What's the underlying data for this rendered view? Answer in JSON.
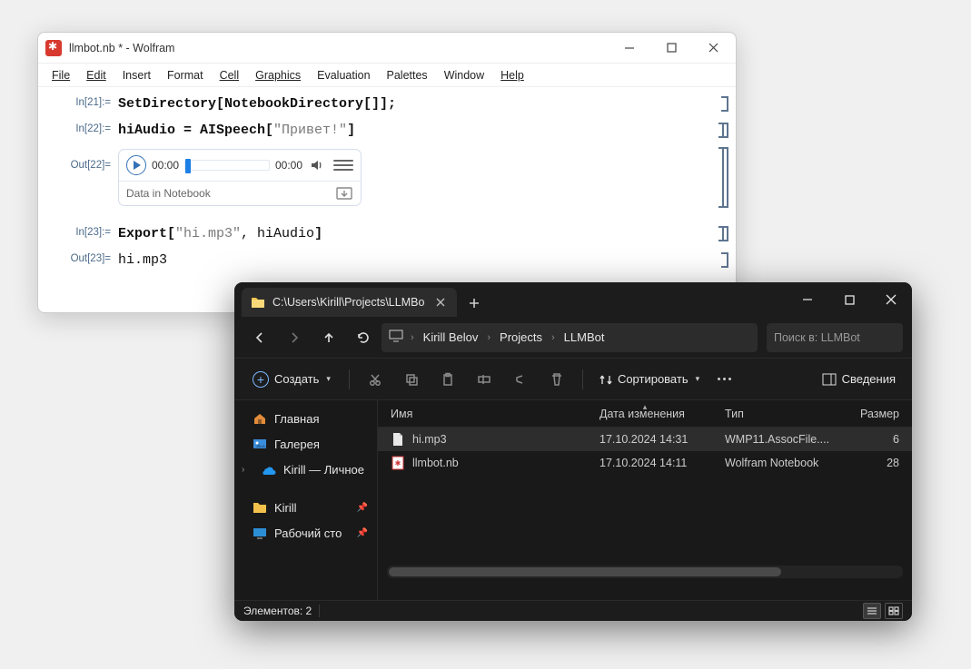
{
  "wolfram": {
    "title": "llmbot.nb * - Wolfram",
    "menu": {
      "file": "File",
      "edit": "Edit",
      "insert": "Insert",
      "format": "Format",
      "cell": "Cell",
      "graphics": "Graphics",
      "evaluation": "Evaluation",
      "palettes": "Palettes",
      "window": "Window",
      "help": "Help"
    },
    "cells": {
      "in21_label": "In[21]:=",
      "in21_code": "SetDirectory[NotebookDirectory[]];",
      "in22_label": "In[22]:=",
      "in22_fn": "hiAudio = AISpeech",
      "in22_str": "\"Привет!\"",
      "out22_label": "Out[22]=",
      "audio": {
        "t1": "00:00",
        "t2": "00:00",
        "caption": "Data in Notebook"
      },
      "in23_label": "In[23]:=",
      "in23_fn": "Export",
      "in23_str": "\"hi.mp3\"",
      "in23_arg2": ", hiAudio",
      "out23_label": "Out[23]=",
      "out23_val": "hi.mp3"
    }
  },
  "explorer": {
    "tab": {
      "title": "C:\\Users\\Kirill\\Projects\\LLMBo"
    },
    "crumbs": {
      "c1": "Kirill Belov",
      "c2": "Projects",
      "c3": "LLMBot"
    },
    "search": {
      "placeholder": "Поиск в: LLMBot"
    },
    "toolbar": {
      "new": "Создать",
      "sort": "Сортировать",
      "details": "Сведения"
    },
    "columns": {
      "name": "Имя",
      "date": "Дата изменения",
      "type": "Тип",
      "size": "Размер"
    },
    "rows": [
      {
        "name": "hi.mp3",
        "date": "17.10.2024 14:31",
        "type": "WMP11.AssocFile....",
        "size": "6"
      },
      {
        "name": "llmbot.nb",
        "date": "17.10.2024 14:11",
        "type": "Wolfram Notebook",
        "size": "28"
      }
    ],
    "sidebar": {
      "home": "Главная",
      "gallery": "Галерея",
      "onedrive": "Kirill — Личное",
      "kirill": "Kirill",
      "desktop": "Рабочий сто"
    },
    "status": {
      "count": "Элементов: 2"
    }
  }
}
